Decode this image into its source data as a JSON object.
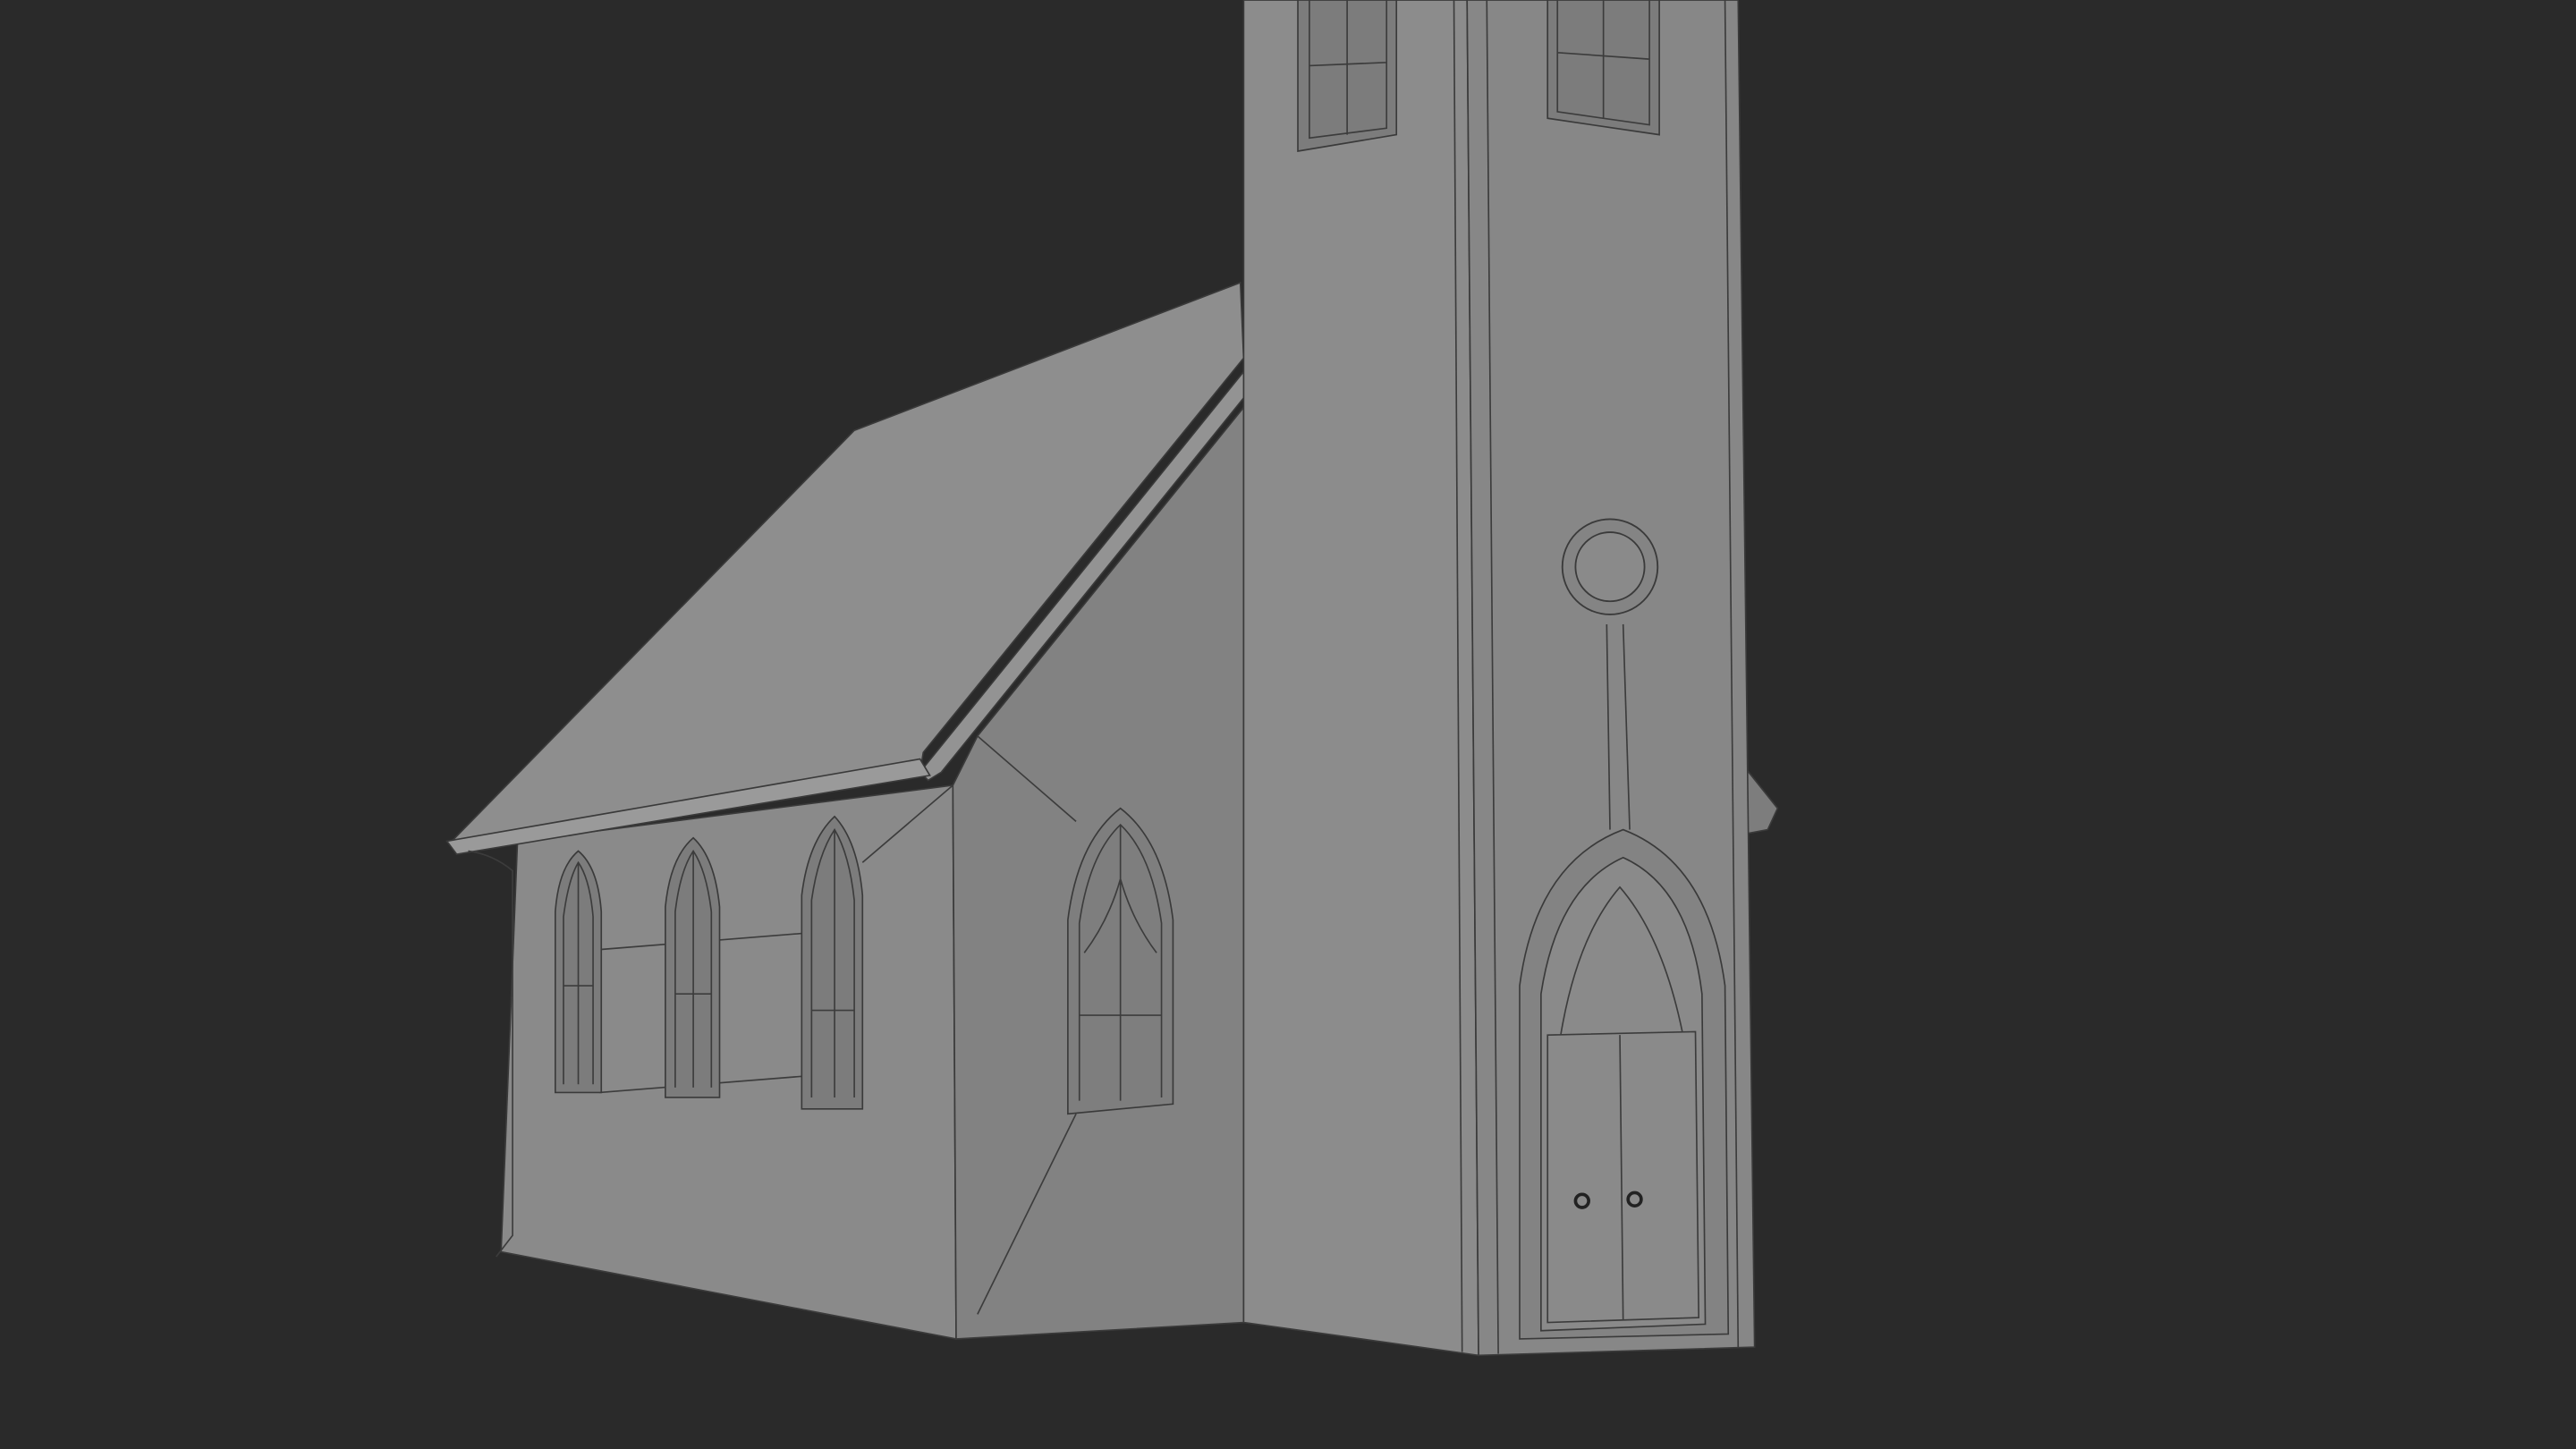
{
  "scene": {
    "subject": "church-model-viewport",
    "colors": {
      "background": "#2a2a2a",
      "wall": "#8b8b8b",
      "wall_shadow": "#7f7f7f",
      "roof": "#8e8e8e",
      "wire": "#3a3a3a"
    }
  }
}
